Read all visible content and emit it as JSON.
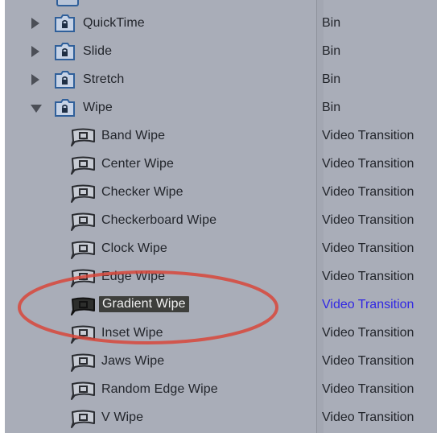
{
  "rows": [
    {
      "name": "QuickTime",
      "kind": "Bin",
      "type": "bin",
      "expanded": false
    },
    {
      "name": "Slide",
      "kind": "Bin",
      "type": "bin",
      "expanded": false
    },
    {
      "name": "Stretch",
      "kind": "Bin",
      "type": "bin",
      "expanded": false
    },
    {
      "name": "Wipe",
      "kind": "Bin",
      "type": "bin",
      "expanded": true
    },
    {
      "name": "Band Wipe",
      "kind": "Video Transition",
      "type": "transition"
    },
    {
      "name": "Center Wipe",
      "kind": "Video Transition",
      "type": "transition"
    },
    {
      "name": "Checker Wipe",
      "kind": "Video Transition",
      "type": "transition"
    },
    {
      "name": "Checkerboard Wipe",
      "kind": "Video Transition",
      "type": "transition"
    },
    {
      "name": "Clock Wipe",
      "kind": "Video Transition",
      "type": "transition"
    },
    {
      "name": "Edge Wipe",
      "kind": "Video Transition",
      "type": "transition"
    },
    {
      "name": "Gradient Wipe",
      "kind": "Video Transition",
      "type": "transition",
      "selected": true
    },
    {
      "name": "Inset Wipe",
      "kind": "Video Transition",
      "type": "transition"
    },
    {
      "name": "Jaws Wipe",
      "kind": "Video Transition",
      "type": "transition"
    },
    {
      "name": "Random Edge Wipe",
      "kind": "Video Transition",
      "type": "transition"
    },
    {
      "name": "V Wipe",
      "kind": "Video Transition",
      "type": "transition"
    }
  ],
  "colors": {
    "background": "#a9adb8",
    "selection": "#3e3f3c",
    "selected_kind_text": "#3127e3",
    "annotation_ellipse": "#d8473a",
    "bin_icon_border": "#2f5f9a"
  }
}
